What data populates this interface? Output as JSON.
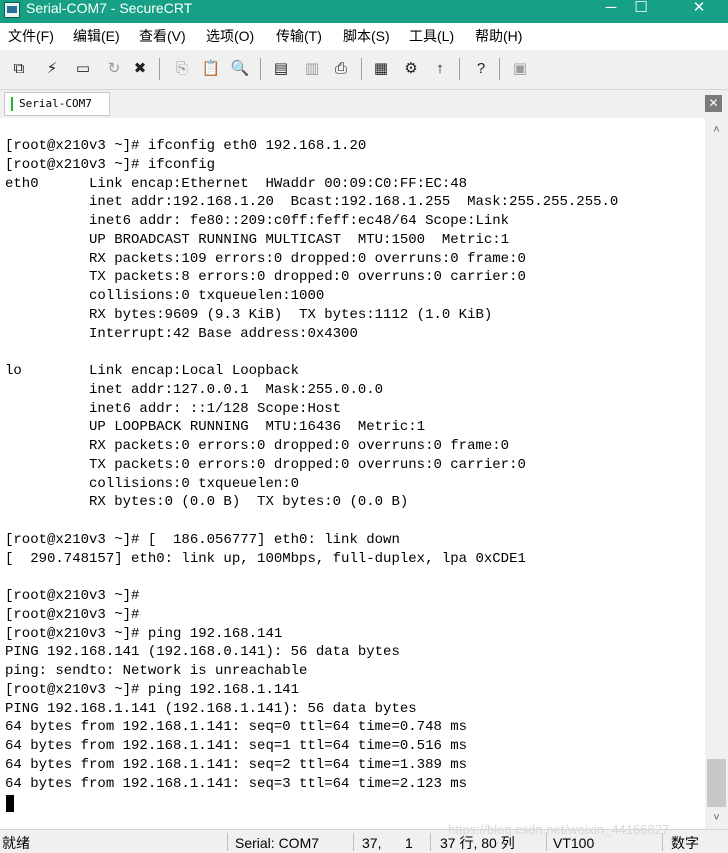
{
  "window": {
    "title": "Serial-COM7 - SecureCRT",
    "controls": {
      "minimize": "─",
      "maximize": "☐",
      "close": "✕"
    }
  },
  "menubar": {
    "items": [
      "文件(F)",
      "编辑(E)",
      "查看(V)",
      "选项(O)",
      "传输(T)",
      "脚本(S)",
      "工具(L)",
      "帮助(H)"
    ]
  },
  "toolbar": {
    "icons": [
      "connect-icon",
      "quick-connect-icon",
      "connect-in-tab-icon",
      "reconnect-icon",
      "disconnect-icon",
      "copy-icon",
      "paste-icon",
      "find-icon",
      "print-setup-icon",
      "log-session-icon",
      "print-icon",
      "session-options-icon",
      "global-options-icon",
      "keymap-icon",
      "help-icon",
      "sftp-icon"
    ]
  },
  "tab": {
    "label": "Serial-COM7",
    "close_glyph": "✕"
  },
  "terminal": {
    "lines": [
      "[root@x210v3 ~]# ifconfig eth0 192.168.1.20",
      "[root@x210v3 ~]# ifconfig",
      "eth0      Link encap:Ethernet  HWaddr 00:09:C0:FF:EC:48",
      "          inet addr:192.168.1.20  Bcast:192.168.1.255  Mask:255.255.255.0",
      "          inet6 addr: fe80::209:c0ff:feff:ec48/64 Scope:Link",
      "          UP BROADCAST RUNNING MULTICAST  MTU:1500  Metric:1",
      "          RX packets:109 errors:0 dropped:0 overruns:0 frame:0",
      "          TX packets:8 errors:0 dropped:0 overruns:0 carrier:0",
      "          collisions:0 txqueuelen:1000",
      "          RX bytes:9609 (9.3 KiB)  TX bytes:1112 (1.0 KiB)",
      "          Interrupt:42 Base address:0x4300",
      "",
      "lo        Link encap:Local Loopback",
      "          inet addr:127.0.0.1  Mask:255.0.0.0",
      "          inet6 addr: ::1/128 Scope:Host",
      "          UP LOOPBACK RUNNING  MTU:16436  Metric:1",
      "          RX packets:0 errors:0 dropped:0 overruns:0 frame:0",
      "          TX packets:0 errors:0 dropped:0 overruns:0 carrier:0",
      "          collisions:0 txqueuelen:0",
      "          RX bytes:0 (0.0 B)  TX bytes:0 (0.0 B)",
      "",
      "[root@x210v3 ~]# [  186.056777] eth0: link down",
      "[  290.748157] eth0: link up, 100Mbps, full-duplex, lpa 0xCDE1",
      "",
      "[root@x210v3 ~]#",
      "[root@x210v3 ~]#",
      "[root@x210v3 ~]# ping 192.168.141",
      "PING 192.168.141 (192.168.0.141): 56 data bytes",
      "ping: sendto: Network is unreachable",
      "[root@x210v3 ~]# ping 192.168.1.141",
      "PING 192.168.1.141 (192.168.1.141): 56 data bytes",
      "64 bytes from 192.168.1.141: seq=0 ttl=64 time=0.748 ms",
      "64 bytes from 192.168.1.141: seq=1 ttl=64 time=0.516 ms",
      "64 bytes from 192.168.1.141: seq=2 ttl=64 time=1.389 ms",
      "64 bytes from 192.168.1.141: seq=3 ttl=64 time=2.123 ms"
    ]
  },
  "scrollbar": {
    "up_arrow": "˄",
    "down_arrow": "˅"
  },
  "statusbar": {
    "ready": "就绪",
    "connection": "Serial: COM7",
    "row": "37,",
    "col": "1",
    "position": "37 行, 80 列",
    "terminal_type": "VT100",
    "num_lock": "数字",
    "watermark": "https://blog.csdn.net/weixin_44166827"
  },
  "colors": {
    "titlebar": "#16a085",
    "tab_active_mark": "#1fb81f"
  }
}
